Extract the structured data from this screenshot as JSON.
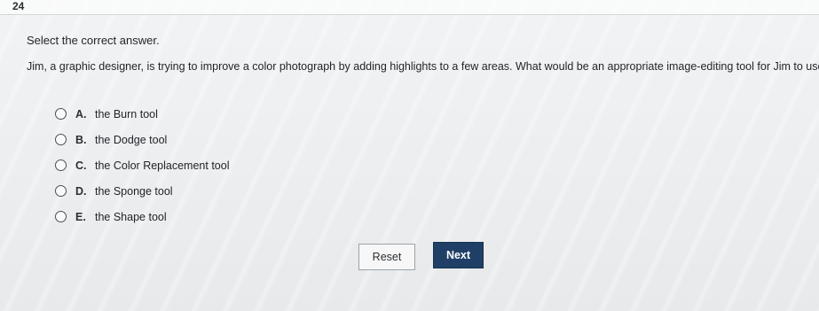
{
  "question_number": "24",
  "instruction": "Select the correct answer.",
  "question": "Jim, a graphic designer, is trying to improve a color photograph by adding highlights to a few areas. What would be an appropriate image-editing tool for Jim to use?",
  "options": [
    {
      "letter": "A.",
      "text": "the Burn tool"
    },
    {
      "letter": "B.",
      "text": "the Dodge tool"
    },
    {
      "letter": "C.",
      "text": "the Color Replacement tool"
    },
    {
      "letter": "D.",
      "text": "the Sponge tool"
    },
    {
      "letter": "E.",
      "text": "the Shape tool"
    }
  ],
  "buttons": {
    "reset": "Reset",
    "next": "Next"
  },
  "colors": {
    "next_button": "#1f3f66",
    "background": "#eceef0"
  }
}
